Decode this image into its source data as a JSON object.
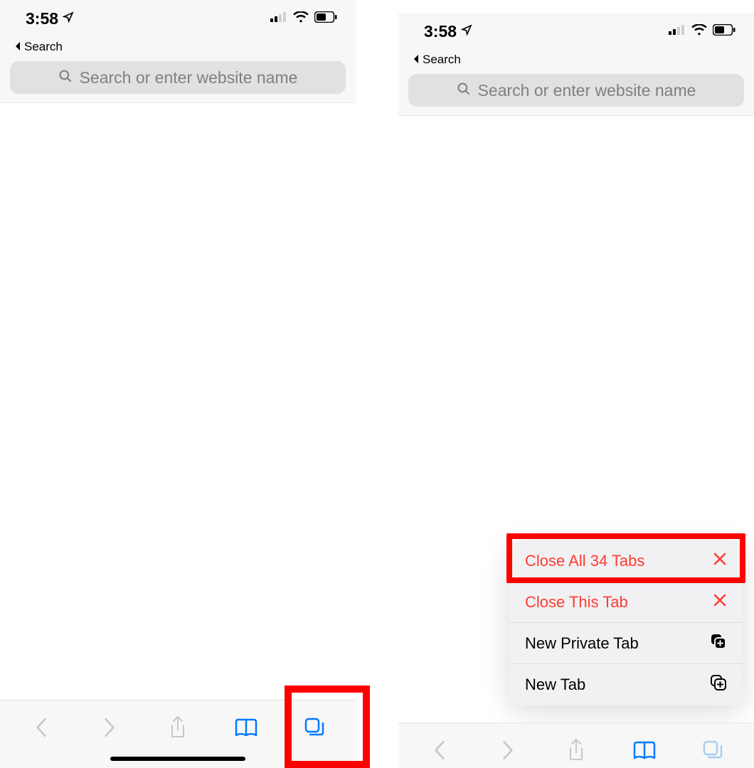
{
  "status": {
    "time": "3:58",
    "back_label": "Search"
  },
  "search": {
    "placeholder": "Search or enter website name"
  },
  "menu": {
    "close_all": "Close All 34 Tabs",
    "close_this": "Close This Tab",
    "new_private": "New Private Tab",
    "new_tab": "New Tab"
  },
  "colors": {
    "destructive": "#ff3b30",
    "accent": "#007aff",
    "disabled": "#c7c7cc"
  }
}
